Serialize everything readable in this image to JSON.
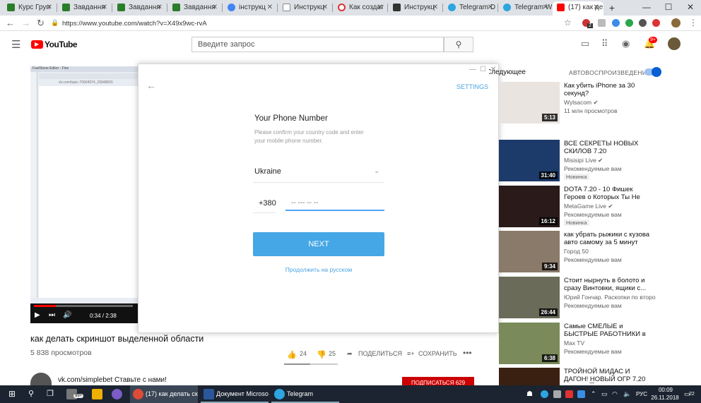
{
  "browser": {
    "tabs": [
      {
        "label": "Курс Груп",
        "icon_color": "#2a7d2a"
      },
      {
        "label": "Завдання",
        "icon_color": "#2a7d2a"
      },
      {
        "label": "Завдання",
        "icon_color": "#2a7d2a"
      },
      {
        "label": "Завдання",
        "icon_color": "#2a7d2a"
      },
      {
        "label": "інструкц",
        "icon_color": "#4285f4"
      },
      {
        "label": "Инструкц",
        "icon_color": "#888888"
      },
      {
        "label": "Как создат",
        "icon_color": "#d33"
      },
      {
        "label": "Инструкц",
        "icon_color": "#333333"
      },
      {
        "label": "Telegram D",
        "icon_color": "#2ca5e0"
      },
      {
        "label": "Telegram W",
        "icon_color": "#2ca5e0"
      },
      {
        "label": "(17) как де",
        "icon_color": "#ff0000"
      }
    ],
    "url": "https://www.youtube.com/watch?v=X49x9wc-rvA",
    "window_buttons": [
      "—",
      "☐",
      "✕"
    ],
    "extension_badge": "2"
  },
  "youtube": {
    "logo": "YouTube",
    "search_placeholder": "Введите запрос",
    "notifications_badge": "9+",
    "video": {
      "title": "как делать скриншот выделенной области",
      "views": "5 838 просмотров",
      "likes": "24",
      "dislikes": "25",
      "share_label": "ПОДЕЛИТЬСЯ",
      "save_label": "СОХРАНИТЬ",
      "time": "0:34 / 2:38",
      "progress": 0.22,
      "screen_url": "vk.com/topic-70604974_29948826"
    },
    "channel": {
      "text": "vk.com/simplebet Ставьте с нами!",
      "subscribe": "ПОДПИСАТЬСЯ 629"
    },
    "sidebar": {
      "up_next": "Следующее",
      "autoplay": "АВТОВОСПРОИЗВЕДЕНИЕ",
      "items": [
        {
          "title": "Как убить iPhone за 30 секунд?",
          "channel": "Wylsacom ✔",
          "meta": "11 млн просмотров",
          "badge": "",
          "duration": "5:13",
          "thumb": "#e9e4df"
        },
        {
          "title": "ВСЕ СЕКРЕТЫ НОВЫХ СКИЛОВ 7.20",
          "channel": "Misisipi Live ✔",
          "meta": "Рекомендуемые вам",
          "badge": "Новинка",
          "duration": "31:40",
          "thumb": "#1c3a6a"
        },
        {
          "title": "DOTA 7.20 - 10 Фишек Героев о Которых Ты Не Знал",
          "channel": "MetaGame Live ✔",
          "meta": "Рекомендуемые вам",
          "badge": "Новинка",
          "duration": "16:12",
          "thumb": "#2a1a1a"
        },
        {
          "title": "как убрать рыжики с кузова авто самому за 5 минут",
          "channel": "Город 50",
          "meta": "Рекомендуемые вам",
          "badge": "",
          "duration": "9:34",
          "thumb": "#8a7a6a"
        },
        {
          "title": "Стоит нырнуть в болото и сразу Винтовки, ящики с...",
          "channel": "Юрий Гончар. Раскопки по второ",
          "meta": "Рекомендуемые вам",
          "badge": "",
          "duration": "26:44",
          "thumb": "#6b6b5a"
        },
        {
          "title": "Самые СМЕЛЫЕ и БЫСТРЫЕ РАБОТНИКИ в Мире",
          "channel": "Max TV",
          "meta": "Рекомендуемые вам",
          "badge": "",
          "duration": "6:38",
          "thumb": "#7a8a5a"
        },
        {
          "title": "ТРОЙНОЙ МИДАС И ДАГОН! НОВЫЙ ОГР 7.20 ДОТА 2 █...",
          "channel": "",
          "meta": "",
          "badge": "",
          "duration": "",
          "thumb": "#3a2010"
        }
      ]
    }
  },
  "telegram_dialog": {
    "settings": "SETTINGS",
    "title": "Your Phone Number",
    "description": "Please confirm your country code and enter your mobile phone number.",
    "country": "Ukraine",
    "code": "+380",
    "phone_placeholder": "-- --- -- --",
    "next": "NEXT",
    "russian_link": "Продолжить на русском"
  },
  "taskbar": {
    "badge": "99+",
    "apps": [
      {
        "label": "(17) как делать скр...",
        "icon_color": "#dd4b39"
      },
      {
        "label": "Документ Microso...",
        "icon_color": "#2b579a"
      },
      {
        "label": "Telegram",
        "icon_color": "#2ca5e0"
      }
    ],
    "lang": "РУС",
    "time": "00:09",
    "date": "26.11.2018",
    "notif": "22"
  }
}
